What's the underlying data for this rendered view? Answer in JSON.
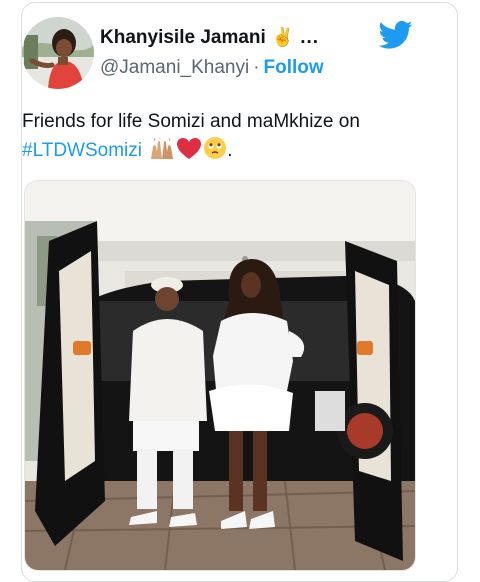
{
  "tweet": {
    "display_name": "Khanyisile Jamani",
    "name_emoji": "✌️",
    "more": "...",
    "handle": "@Jamani_Khanyi",
    "separator": "·",
    "follow_label": "Follow",
    "text_line1": "Friends for life Somizi and maMkhize on",
    "hashtag": "#LTDWSomizi",
    "text_end": ".",
    "emojis": [
      "raising-hands-emoji",
      "red-heart-emoji",
      "pleading-face-emoji"
    ]
  },
  "icons": {
    "brand": "twitter-bird-icon",
    "verified": "victory-hand-emoji"
  },
  "colors": {
    "accent": "#1d9bf0",
    "text": "#0f1419",
    "secondary": "#5b6670",
    "border": "#d9dde1"
  }
}
